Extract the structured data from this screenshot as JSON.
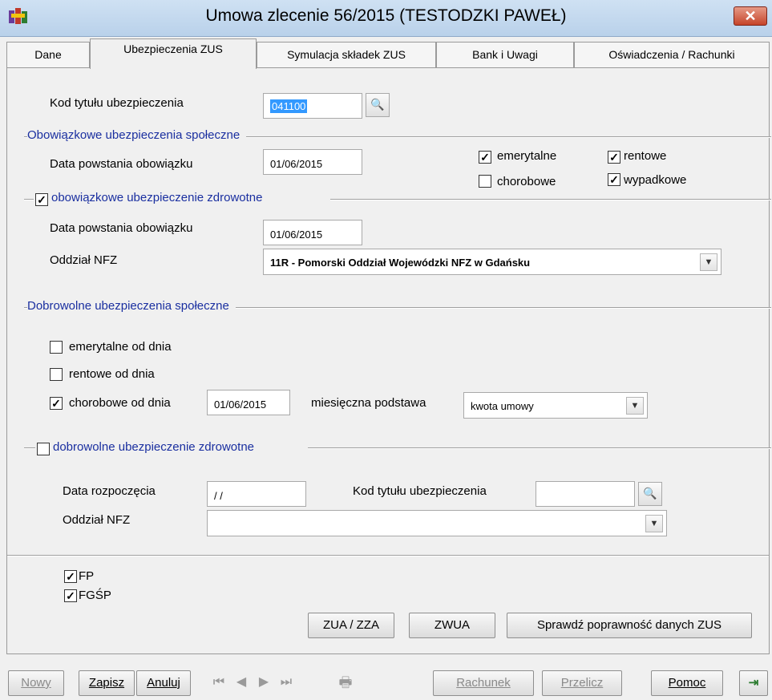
{
  "window": {
    "title": "Umowa zlecenie 56/2015 (TESTODZKI PAWEŁ)",
    "close_label": "✕"
  },
  "tabs": [
    {
      "label": "Dane"
    },
    {
      "label": "Ubezpieczenia ZUS"
    },
    {
      "label": "Symulacja składek ZUS"
    },
    {
      "label": "Bank i Uwagi"
    },
    {
      "label": "Oświadczenia / Rachunki"
    }
  ],
  "insurance_code": {
    "label": "Kod tytułu ubezpieczenia",
    "value": "041100"
  },
  "mandatory_social": {
    "title": "Obowiązkowe ubezpieczenia społeczne",
    "date_label": "Data powstania obowiązku",
    "date_value": "01/06/2015",
    "emerytalne": {
      "label": "emerytalne",
      "checked": true
    },
    "rentowe": {
      "label": "rentowe",
      "checked": true
    },
    "chorobowe": {
      "label": "chorobowe",
      "checked": false
    },
    "wypadkowe": {
      "label": "wypadkowe",
      "checked": true
    }
  },
  "mandatory_health": {
    "title": "obowiązkowe ubezpieczenie zdrowotne",
    "checked": true,
    "date_label": "Data powstania obowiązku",
    "date_value": "01/06/2015",
    "nfz_label": "Oddział NFZ",
    "nfz_value": "11R - Pomorski Oddział Wojewódzki NFZ w Gdańsku"
  },
  "voluntary_social": {
    "title": "Dobrowolne ubezpieczenia społeczne",
    "emerytalne": {
      "label": "emerytalne od dnia",
      "checked": false
    },
    "rentowe": {
      "label": "rentowe od dnia",
      "checked": false
    },
    "chorobowe": {
      "label": "chorobowe od dnia",
      "checked": true,
      "date": "01/06/2015"
    },
    "basis_label": "miesięczna podstawa",
    "basis_value": "kwota umowy"
  },
  "voluntary_health": {
    "title": "dobrowolne ubezpieczenie zdrowotne",
    "checked": false,
    "start_label": "Data rozpoczęcia",
    "start_value": "/ /",
    "code_label": "Kod tytułu ubezpieczenia",
    "code_value": "",
    "nfz_label": "Oddział NFZ",
    "nfz_value": ""
  },
  "funds": {
    "fp": {
      "label": "FP",
      "checked": true
    },
    "fgsp": {
      "label": "FGŚP",
      "checked": true
    }
  },
  "panel_buttons": {
    "zua": "ZUA / ZZA",
    "zwua": "ZWUA",
    "check": "Sprawdź poprawność danych ZUS"
  },
  "toolbar": {
    "new": "Nowy",
    "save": "Zapisz",
    "cancel": "Anuluj",
    "invoice": "Rachunek",
    "recalc": "Przelicz",
    "help": "Pomoc"
  },
  "check_mark": "✓",
  "colors": {
    "section_title": "#1a2fa0",
    "selection": "#3399ff",
    "close_button": "#c6442a"
  }
}
